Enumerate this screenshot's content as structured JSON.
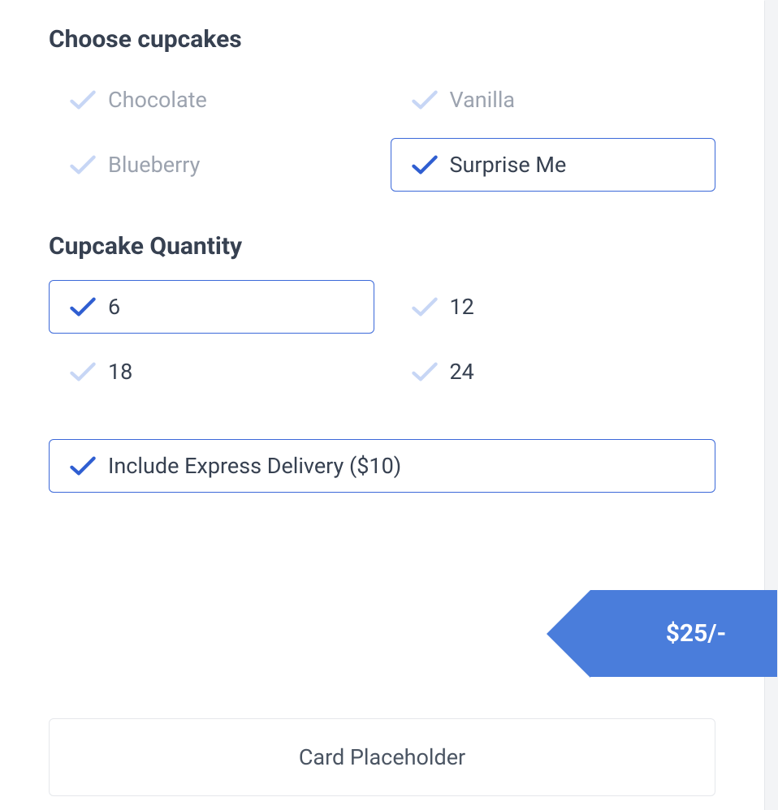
{
  "sections": {
    "flavors": {
      "heading": "Choose cupcakes",
      "options": [
        {
          "label": "Chocolate",
          "selected": false
        },
        {
          "label": "Vanilla",
          "selected": false
        },
        {
          "label": "Blueberry",
          "selected": false
        },
        {
          "label": "Surprise Me",
          "selected": true
        }
      ]
    },
    "quantity": {
      "heading": "Cupcake Quantity",
      "options": [
        {
          "label": "6",
          "selected": true
        },
        {
          "label": "12",
          "selected": false
        },
        {
          "label": "18",
          "selected": false
        },
        {
          "label": "24",
          "selected": false
        }
      ]
    },
    "express": {
      "label": "Include Express Delivery ($10)",
      "selected": true
    }
  },
  "price": {
    "display": "$25/-"
  },
  "card_placeholder": "Card Placeholder",
  "colors": {
    "primary": "#4a7ddb",
    "check_pale": "#c7d6f5",
    "check_blue": "#2f5ed1",
    "border": "#e5e7eb"
  }
}
